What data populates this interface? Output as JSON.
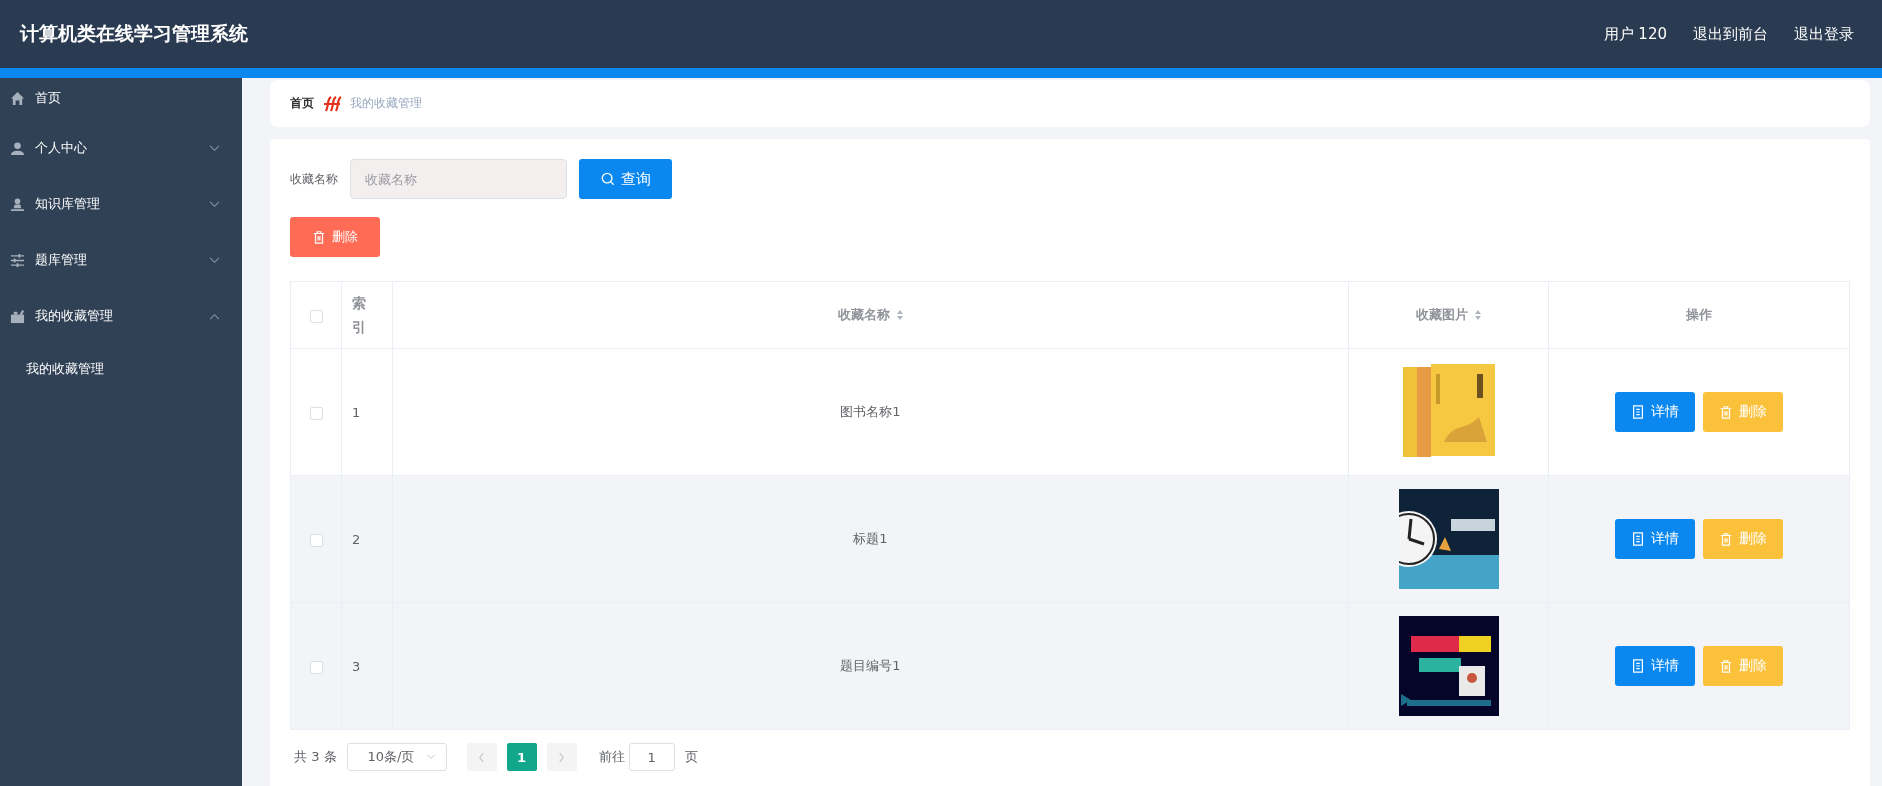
{
  "header": {
    "title": "计算机类在线学习管理系统",
    "links": [
      "用户 120",
      "退出到前台",
      "退出登录"
    ]
  },
  "sidebar": {
    "items": [
      {
        "label": "首页",
        "kind": "link"
      },
      {
        "label": "个人中心",
        "kind": "menu",
        "expanded": false
      },
      {
        "label": "知识库管理",
        "kind": "menu",
        "expanded": false
      },
      {
        "label": "题库管理",
        "kind": "menu",
        "expanded": false
      },
      {
        "label": "我的收藏管理",
        "kind": "menu",
        "expanded": true,
        "children": [
          {
            "label": "我的收藏管理"
          }
        ]
      }
    ]
  },
  "breadcrumb": [
    "首页",
    "我的收藏管理"
  ],
  "search": {
    "label": "收藏名称",
    "placeholder": "收藏名称",
    "button": "查询"
  },
  "delete_button": "删除",
  "table": {
    "select_all_checked": false,
    "columns": [
      {
        "kind": "check"
      },
      {
        "label": "索引",
        "kind": "index",
        "sortable": false
      },
      {
        "label": "收藏名称",
        "kind": "text",
        "sortable": true
      },
      {
        "label": "收藏图片",
        "sortable": true
      },
      {
        "label": "操作",
        "kind": "actions",
        "sortable": false
      }
    ],
    "rows": [
      {
        "checked": false,
        "highlighted": false,
        "index": "1",
        "name": "图书名称1",
        "image": {
          "kind": "picture"
        },
        "actions": [
          "详情",
          "删除"
        ]
      },
      {
        "checked": false,
        "highlighted": true,
        "index": "2",
        "name": "标题1",
        "image": {
          "kind": "picture"
        },
        "actions": [
          "详情",
          "删除"
        ]
      },
      {
        "checked": false,
        "highlighted": true,
        "index": "3",
        "name": "题目编号1",
        "image": {
          "kind": "picture"
        },
        "actions": [
          "详情",
          "删除"
        ]
      }
    ]
  },
  "pagination": {
    "total": "共 3 条",
    "page_size": "10条/页",
    "pages": [
      {
        "label": "1",
        "selected": true
      }
    ],
    "goto_label": "前往",
    "goto_value": "1",
    "page_unit": "页"
  }
}
